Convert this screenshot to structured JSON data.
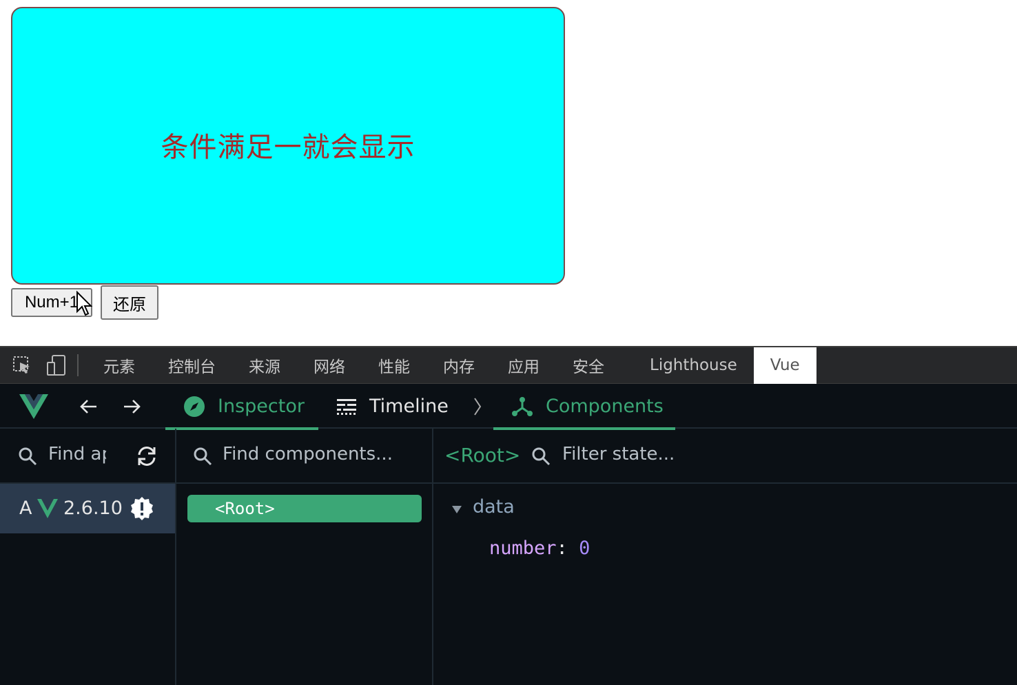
{
  "page": {
    "box_text": "条件满足一就会显示",
    "buttons": {
      "increment": "Num+1",
      "reset": "还原"
    }
  },
  "devtools": {
    "icons": [
      "inspect-element-icon",
      "device-toggle-icon"
    ],
    "tabs": [
      "元素",
      "控制台",
      "来源",
      "网络",
      "性能",
      "内存",
      "应用",
      "安全",
      "Lighthouse",
      "Vue"
    ],
    "active_tab": "Vue"
  },
  "vue": {
    "nav": {
      "inspector": "Inspector",
      "timeline": "Timeline",
      "components": "Components"
    },
    "apps": {
      "search_placeholder": "Find apps...",
      "app_letter": "A",
      "version": "2.6.10"
    },
    "components": {
      "search_placeholder": "Find components...",
      "root_label": "<Root>"
    },
    "state": {
      "selected": "<Root>",
      "filter_placeholder": "Filter state...",
      "section": "data",
      "key": "number",
      "colon": ":",
      "value": "0"
    },
    "colors": {
      "accent": "#3ba776",
      "key": "#d7a6ff",
      "value": "#a78bfa"
    }
  }
}
